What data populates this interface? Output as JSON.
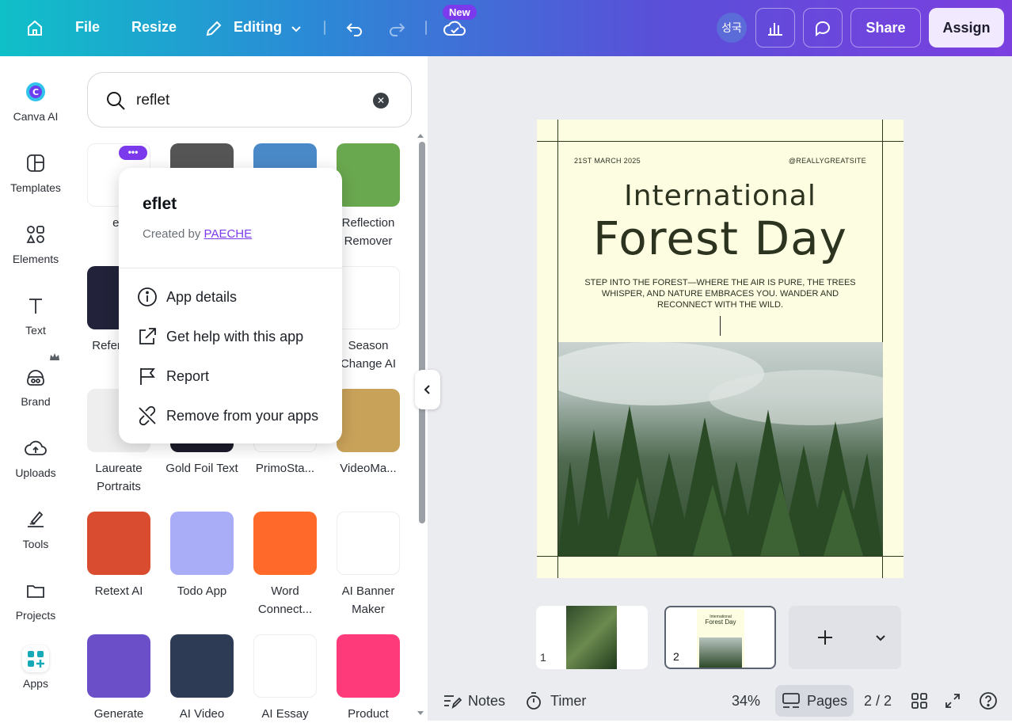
{
  "topbar": {
    "file": "File",
    "resize": "Resize",
    "editing": "Editing",
    "new_badge": "New",
    "avatar": "성국",
    "share": "Share",
    "assign": "Assign"
  },
  "rail": {
    "items": [
      {
        "label": "Canva AI"
      },
      {
        "label": "Templates"
      },
      {
        "label": "Elements"
      },
      {
        "label": "Text"
      },
      {
        "label": "Brand"
      },
      {
        "label": "Uploads"
      },
      {
        "label": "Tools"
      },
      {
        "label": "Projects"
      },
      {
        "label": "Apps"
      }
    ]
  },
  "search": {
    "value": "reflet"
  },
  "apps": [
    {
      "name": "efl",
      "color": "#ffffff"
    },
    {
      "name": "",
      "color": "#555555"
    },
    {
      "name": "",
      "color": "#4a89c8"
    },
    {
      "name": "Reflection Remover",
      "color": "#6aa84f"
    },
    {
      "name": "Refer to V",
      "color": "#22223a"
    },
    {
      "name": "",
      "color": "#ffffff"
    },
    {
      "name": "",
      "color": "#ffffff"
    },
    {
      "name": "Season Change AI",
      "color": "#ffffff"
    },
    {
      "name": "Laureate Portraits",
      "color": "#eeeeee"
    },
    {
      "name": "Gold Foil Text",
      "color": "#1b1b2a"
    },
    {
      "name": "PrimoSta...",
      "color": "#ffffff"
    },
    {
      "name": "VideoMa...",
      "color": "#c9a25a"
    },
    {
      "name": "Retext AI",
      "color": "#d94c2f"
    },
    {
      "name": "Todo App",
      "color": "#a9adf7"
    },
    {
      "name": "Word Connect...",
      "color": "#ff6a2b"
    },
    {
      "name": "AI Banner Maker",
      "color": "#ffffff"
    },
    {
      "name": "Generate",
      "color": "#6b4fc9"
    },
    {
      "name": "AI Video",
      "color": "#2d3b55"
    },
    {
      "name": "AI Essay",
      "color": "#ffffff"
    },
    {
      "name": "Product",
      "color": "#ff3a7a"
    }
  ],
  "popup": {
    "title": "eflet",
    "created_by": "Created by",
    "author": "PAECHE",
    "items": [
      {
        "label": "App details"
      },
      {
        "label": "Get help with this app"
      },
      {
        "label": "Report"
      },
      {
        "label": "Remove from your apps"
      }
    ]
  },
  "design": {
    "date": "21ST MARCH 2025",
    "site": "@REALLYGREATSITE",
    "title_1": "International",
    "title_2": "Forest Day",
    "body": "STEP INTO THE FOREST—WHERE THE AIR IS PURE, THE TREES WHISPER, AND NATURE EMBRACES YOU. WANDER AND RECONNECT WITH THE WILD."
  },
  "pages": {
    "page1_num": "1",
    "page2_num": "2",
    "thumb_title_1": "International",
    "thumb_title_2": "Forest Day"
  },
  "bottom": {
    "notes": "Notes",
    "timer": "Timer",
    "zoom": "34%",
    "pages": "Pages",
    "page_count": "2 / 2"
  }
}
